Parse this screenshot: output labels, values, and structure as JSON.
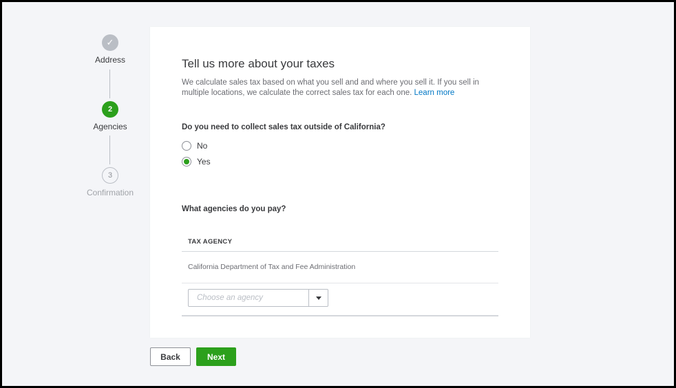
{
  "stepper": {
    "steps": [
      {
        "label": "Address",
        "marker": "✓",
        "state": "complete"
      },
      {
        "label": "Agencies",
        "marker": "2",
        "state": "active"
      },
      {
        "label": "Confirmation",
        "marker": "3",
        "state": "upcoming"
      }
    ]
  },
  "main": {
    "title": "Tell us more about your taxes",
    "description": "We calculate sales tax based on what you sell and and where you sell it. If you sell in multiple locations, we calculate the correct sales tax for each one.",
    "learn_more": "Learn more",
    "question_outside": "Do you need to collect sales tax outside of California?",
    "options": [
      {
        "label": "No",
        "selected": false
      },
      {
        "label": "Yes",
        "selected": true
      }
    ],
    "question_agencies": "What agencies do you pay?",
    "table": {
      "header": "TAX AGENCY",
      "rows": [
        "California Department of Tax and Fee Administration"
      ]
    },
    "agency_select_placeholder": "Choose an agency"
  },
  "footer": {
    "back_label": "Back",
    "next_label": "Next"
  },
  "colors": {
    "accent_green": "#2ca01c",
    "link_blue": "#0077c5",
    "background": "#f4f5f8"
  },
  "icons": {
    "check": "check-icon",
    "caret": "chevron-down-icon"
  }
}
